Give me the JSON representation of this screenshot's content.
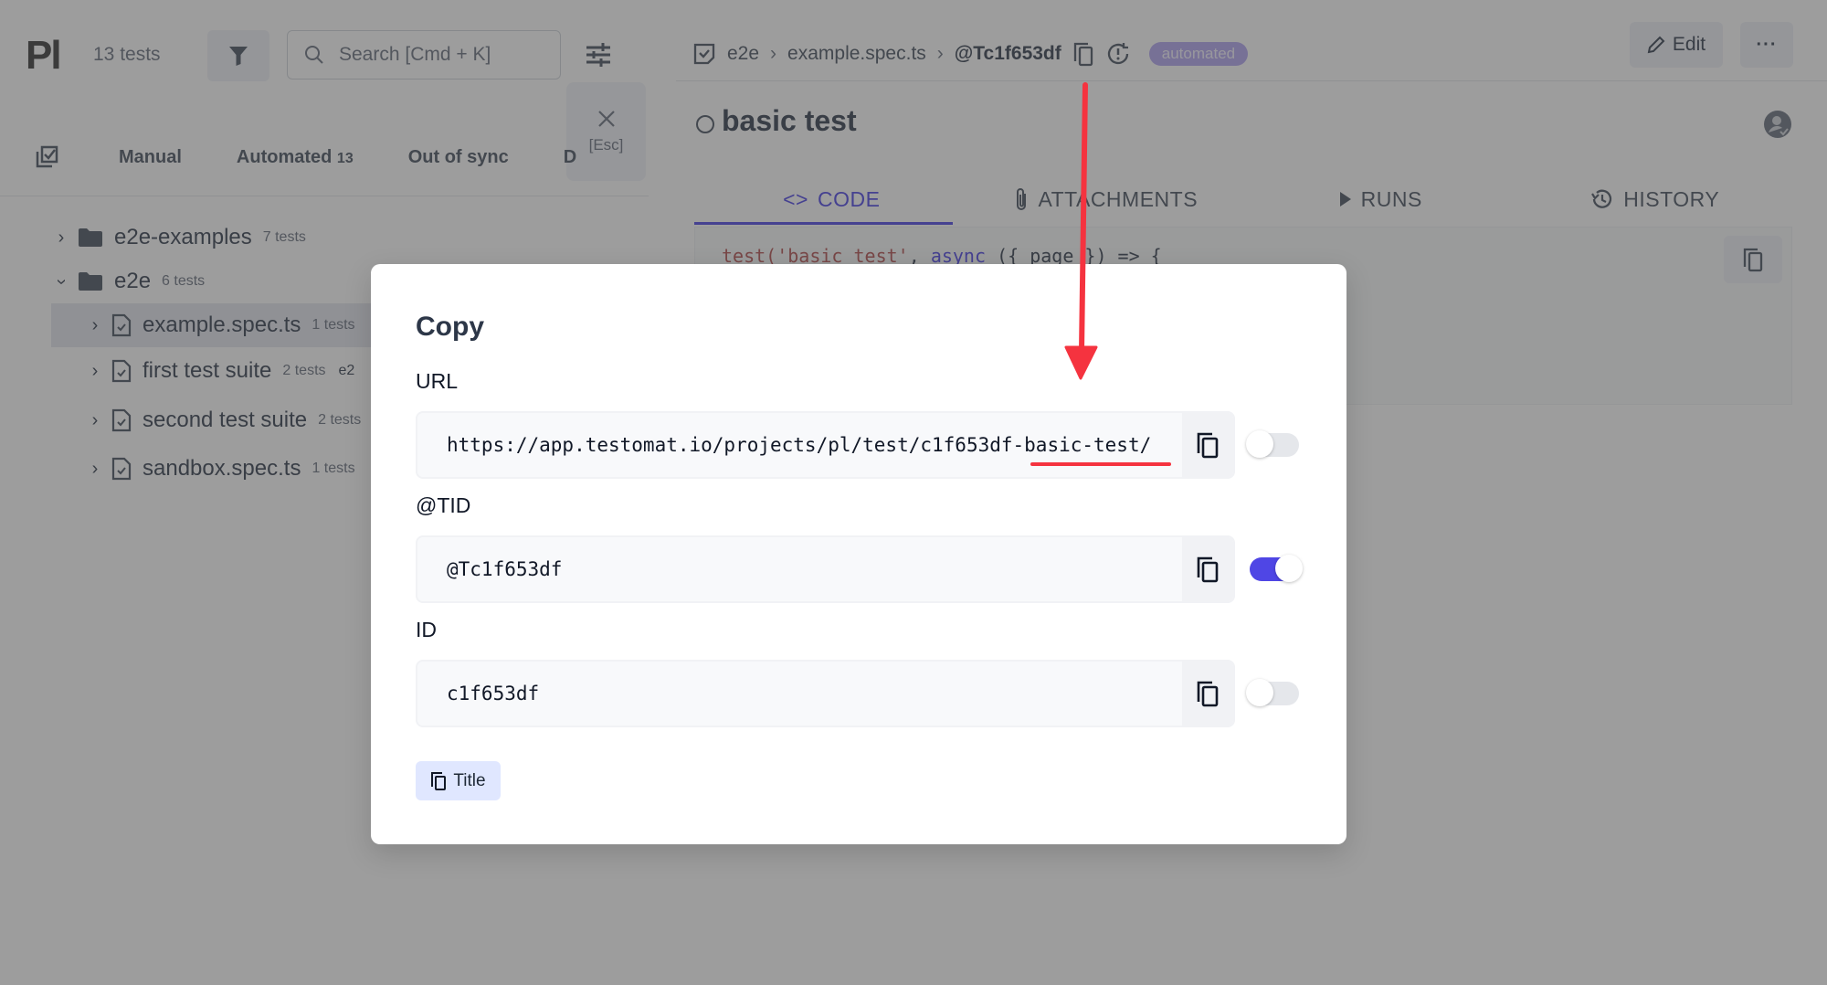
{
  "app": {
    "logo": "Pl",
    "test_count": "13 tests",
    "search_placeholder": "Search [Cmd + K]",
    "close_panel": {
      "esc_label": "[Esc]"
    }
  },
  "left_tabs": [
    {
      "label": "Manual",
      "count": ""
    },
    {
      "label": "Automated",
      "count": "13"
    },
    {
      "label": "Out of sync",
      "count": ""
    },
    {
      "label": "D",
      "count": ""
    }
  ],
  "tree": [
    {
      "name": "e2e-examples",
      "meta": "7 tests",
      "type": "folder",
      "expanded": false,
      "level": 0
    },
    {
      "name": "e2e",
      "meta": "6 tests",
      "type": "folder",
      "expanded": true,
      "level": 0
    },
    {
      "name": "example.spec.ts",
      "meta": "1 tests",
      "type": "file",
      "expanded": false,
      "level": 1,
      "selected": true
    },
    {
      "name": "first test suite",
      "meta": "2 tests",
      "type": "file",
      "expanded": false,
      "level": 1,
      "extra": "e2"
    },
    {
      "name": "second test suite",
      "meta": "2 tests",
      "type": "file",
      "expanded": false,
      "level": 1
    },
    {
      "name": "sandbox.spec.ts",
      "meta": "1 tests",
      "type": "file",
      "expanded": false,
      "level": 1
    }
  ],
  "breadcrumb": {
    "items": [
      "e2e",
      "example.spec.ts"
    ],
    "separator": "›",
    "tid": "@Tc1f653df",
    "badge": "automated"
  },
  "header_actions": {
    "edit_label": "Edit",
    "more_label": "···"
  },
  "test": {
    "title": "basic test",
    "tabs": [
      {
        "label": "CODE",
        "icon": "code-icon",
        "active": true
      },
      {
        "label": "ATTACHMENTS",
        "icon": "paperclip-icon",
        "active": false
      },
      {
        "label": "RUNS",
        "icon": "play-icon",
        "active": false
      },
      {
        "label": "HISTORY",
        "icon": "history-icon",
        "active": false
      }
    ],
    "code": {
      "fn": "test(",
      "str": "'basic test'",
      "comma": ", ",
      "kw": "async",
      "rest": " ({ page }) => {"
    }
  },
  "modal": {
    "title": "Copy",
    "fields": [
      {
        "label": "URL",
        "value": "https://app.testomat.io/projects/pl/test/c1f653df-basic-test/",
        "toggle_on": false
      },
      {
        "label": "@TID",
        "value": "@Tc1f653df",
        "toggle_on": true
      },
      {
        "label": "ID",
        "value": "c1f653df",
        "toggle_on": false
      }
    ],
    "title_button": "Title"
  },
  "colors": {
    "accent": "#4f46e5",
    "annotation": "#f5333f",
    "badge": "#b3a6f0"
  }
}
